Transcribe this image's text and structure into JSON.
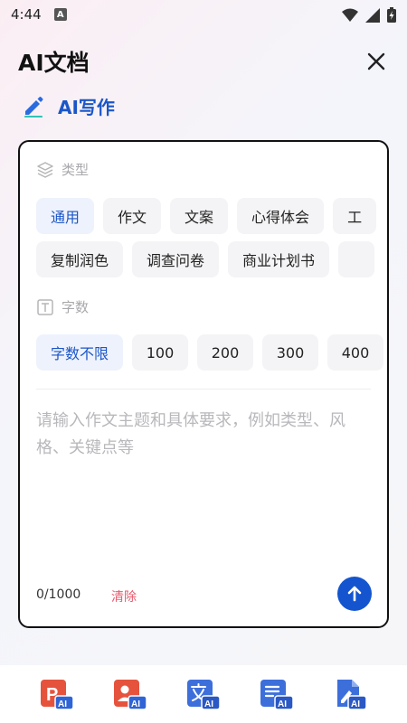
{
  "status": {
    "time": "4:44",
    "badge": "A"
  },
  "header": {
    "title": "AI文档"
  },
  "subheader": {
    "label": "AI写作"
  },
  "type_section": {
    "label": "类型",
    "row1": [
      "通用",
      "作文",
      "文案",
      "心得体会",
      "工"
    ],
    "row2": [
      "复制润色",
      "调查问卷",
      "商业计划书",
      ""
    ]
  },
  "words_section": {
    "label": "字数",
    "options": [
      "字数不限",
      "100",
      "200",
      "300",
      "400"
    ]
  },
  "input": {
    "placeholder": "请输入作文主题和具体要求，例如类型、风格、关键点等",
    "counter": "0/1000",
    "clear_label": "清除"
  },
  "tools": [
    {
      "icon": "ppt-ai-icon",
      "badge": "AI",
      "color": "#e5533d"
    },
    {
      "icon": "resume-ai-icon",
      "badge": "AI",
      "color": "#e5533d"
    },
    {
      "icon": "translate-ai-icon",
      "badge": "AI",
      "color": "#3d6fdb"
    },
    {
      "icon": "document-ai-icon",
      "badge": "AI",
      "color": "#3d6fdb"
    },
    {
      "icon": "write-ai-icon",
      "badge": "AI",
      "color": "#3d6fdb"
    }
  ],
  "colors": {
    "accent": "#1b56c7",
    "send": "#1455cf",
    "clear": "#e85a6e"
  }
}
